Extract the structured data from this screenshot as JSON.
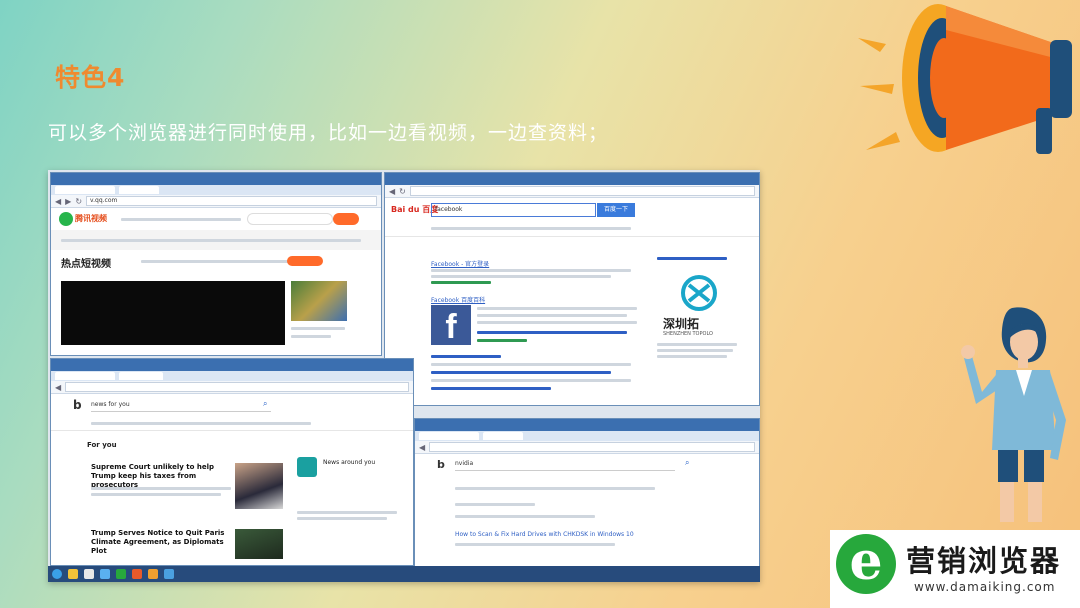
{
  "slide": {
    "title": "特色4",
    "subtitle": "可以多个浏览器进行同时使用，比如一边看视频，一边查资料；"
  },
  "screenshot": {
    "video_window": {
      "url": "v.qq.com",
      "brand": "腾讯视频",
      "section": "热点短视频"
    },
    "baidu_window": {
      "logo": "Bai du 百度",
      "query": "facebook",
      "search_button": "百度一下",
      "result_title_1": "Facebook - 官方登录",
      "result_title_2": "Facebook 百度百科",
      "side_logo_cn": "深圳拓",
      "side_logo_en": "SHENZHEN TOPOLO"
    },
    "bing_window": {
      "query": "news for you",
      "section": "For you",
      "headline_1": "Supreme Court unlikely to help Trump keep his taxes from prosecutors",
      "headline_2": "Trump Serves Notice to Quit Paris Climate Agreement, as Diplomats Plot",
      "side_card": "News around you"
    },
    "bing_window_2": {
      "query": "nvidia",
      "result_link": "How to Scan & Fix Hard Drives with CHKDSK in Windows 10"
    }
  },
  "brand_logo": {
    "letter": "e",
    "name": "营销浏览器",
    "url": "www.damaiking.com"
  },
  "colors": {
    "title_orange": "#ef8a2f",
    "brand_green": "#27a83c",
    "megaphone_orange": "#f26a1b"
  }
}
